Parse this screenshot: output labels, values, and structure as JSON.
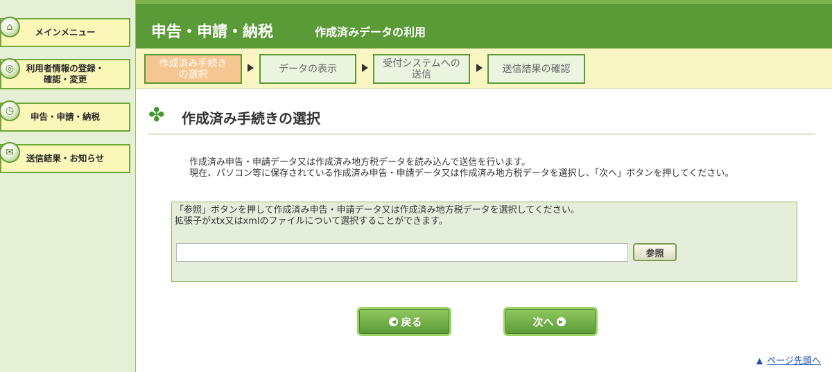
{
  "sidebar": {
    "items": [
      {
        "label": "メインメニュー",
        "icon": "home-icon"
      },
      {
        "label": "利用者情報の登録・確認・変更",
        "line1": "利用者情報の登録・",
        "line2": "確認・変更",
        "icon": "user-settings-icon"
      },
      {
        "label": "申告・申請・納税",
        "icon": "clock-icon"
      },
      {
        "label": "送信結果・お知らせ",
        "icon": "message-icon"
      }
    ]
  },
  "header": {
    "title": "申告・申請・納税",
    "subtitle": "作成済みデータの利用"
  },
  "steps": [
    {
      "line1": "作成済み手続き",
      "line2": "の選択",
      "active": true
    },
    {
      "line1": "データの表示",
      "line2": "",
      "active": false
    },
    {
      "line1": "受付システムへの",
      "line2": "送信",
      "active": false
    },
    {
      "line1": "送信結果の確認",
      "line2": "",
      "active": false
    }
  ],
  "main": {
    "page_title": "作成済み手続きの選択",
    "description_line1": "作成済み申告・申請データ又は作成済み地方税データを読み込んで送信を行います。",
    "description_line2": "現在、パソコン等に保存されている作成済み申告・申請データ又は作成済み地方税データを選択し、「次へ」ボタンを押してください。",
    "panel_line1": "「参照」ボタンを押して作成済み申告・申請データ又は作成済み地方税データを選択してください。",
    "panel_line2": "拡張子がxtx又はxmlのファイルについて選択することができます。",
    "file_value": "",
    "browse_label": "参照",
    "back_label": "戻る",
    "next_label": "次へ",
    "page_top_link": "ページ先頭へ"
  },
  "colors": {
    "header_green": "#5a9a37",
    "sidebar_button": "#fbf7b8",
    "active_step": "#f6c690",
    "link_blue": "#1a4fb0"
  }
}
